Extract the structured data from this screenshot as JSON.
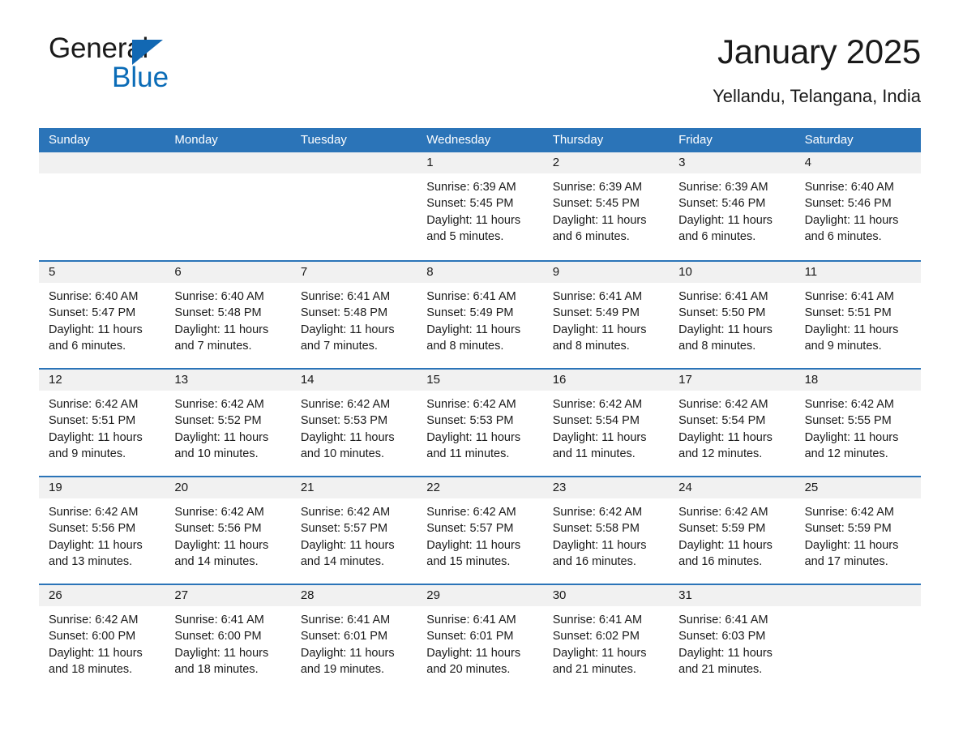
{
  "brand": {
    "name_part1": "General",
    "name_part2": "Blue",
    "triangle_color": "#1268b3"
  },
  "header": {
    "month_title": "January 2025",
    "location": "Yellandu, Telangana, India"
  },
  "theme": {
    "header_blue": "#2b74b8",
    "daynum_band": "#f1f1f1",
    "text": "#1a1a1a"
  },
  "weekdays": [
    "Sunday",
    "Monday",
    "Tuesday",
    "Wednesday",
    "Thursday",
    "Friday",
    "Saturday"
  ],
  "weeks": [
    [
      {
        "day": "",
        "sunrise": "",
        "sunset": "",
        "daylight_line1": "",
        "daylight_line2": ""
      },
      {
        "day": "",
        "sunrise": "",
        "sunset": "",
        "daylight_line1": "",
        "daylight_line2": ""
      },
      {
        "day": "",
        "sunrise": "",
        "sunset": "",
        "daylight_line1": "",
        "daylight_line2": ""
      },
      {
        "day": "1",
        "sunrise": "Sunrise: 6:39 AM",
        "sunset": "Sunset: 5:45 PM",
        "daylight_line1": "Daylight: 11 hours",
        "daylight_line2": "and 5 minutes."
      },
      {
        "day": "2",
        "sunrise": "Sunrise: 6:39 AM",
        "sunset": "Sunset: 5:45 PM",
        "daylight_line1": "Daylight: 11 hours",
        "daylight_line2": "and 6 minutes."
      },
      {
        "day": "3",
        "sunrise": "Sunrise: 6:39 AM",
        "sunset": "Sunset: 5:46 PM",
        "daylight_line1": "Daylight: 11 hours",
        "daylight_line2": "and 6 minutes."
      },
      {
        "day": "4",
        "sunrise": "Sunrise: 6:40 AM",
        "sunset": "Sunset: 5:46 PM",
        "daylight_line1": "Daylight: 11 hours",
        "daylight_line2": "and 6 minutes."
      }
    ],
    [
      {
        "day": "5",
        "sunrise": "Sunrise: 6:40 AM",
        "sunset": "Sunset: 5:47 PM",
        "daylight_line1": "Daylight: 11 hours",
        "daylight_line2": "and 6 minutes."
      },
      {
        "day": "6",
        "sunrise": "Sunrise: 6:40 AM",
        "sunset": "Sunset: 5:48 PM",
        "daylight_line1": "Daylight: 11 hours",
        "daylight_line2": "and 7 minutes."
      },
      {
        "day": "7",
        "sunrise": "Sunrise: 6:41 AM",
        "sunset": "Sunset: 5:48 PM",
        "daylight_line1": "Daylight: 11 hours",
        "daylight_line2": "and 7 minutes."
      },
      {
        "day": "8",
        "sunrise": "Sunrise: 6:41 AM",
        "sunset": "Sunset: 5:49 PM",
        "daylight_line1": "Daylight: 11 hours",
        "daylight_line2": "and 8 minutes."
      },
      {
        "day": "9",
        "sunrise": "Sunrise: 6:41 AM",
        "sunset": "Sunset: 5:49 PM",
        "daylight_line1": "Daylight: 11 hours",
        "daylight_line2": "and 8 minutes."
      },
      {
        "day": "10",
        "sunrise": "Sunrise: 6:41 AM",
        "sunset": "Sunset: 5:50 PM",
        "daylight_line1": "Daylight: 11 hours",
        "daylight_line2": "and 8 minutes."
      },
      {
        "day": "11",
        "sunrise": "Sunrise: 6:41 AM",
        "sunset": "Sunset: 5:51 PM",
        "daylight_line1": "Daylight: 11 hours",
        "daylight_line2": "and 9 minutes."
      }
    ],
    [
      {
        "day": "12",
        "sunrise": "Sunrise: 6:42 AM",
        "sunset": "Sunset: 5:51 PM",
        "daylight_line1": "Daylight: 11 hours",
        "daylight_line2": "and 9 minutes."
      },
      {
        "day": "13",
        "sunrise": "Sunrise: 6:42 AM",
        "sunset": "Sunset: 5:52 PM",
        "daylight_line1": "Daylight: 11 hours",
        "daylight_line2": "and 10 minutes."
      },
      {
        "day": "14",
        "sunrise": "Sunrise: 6:42 AM",
        "sunset": "Sunset: 5:53 PM",
        "daylight_line1": "Daylight: 11 hours",
        "daylight_line2": "and 10 minutes."
      },
      {
        "day": "15",
        "sunrise": "Sunrise: 6:42 AM",
        "sunset": "Sunset: 5:53 PM",
        "daylight_line1": "Daylight: 11 hours",
        "daylight_line2": "and 11 minutes."
      },
      {
        "day": "16",
        "sunrise": "Sunrise: 6:42 AM",
        "sunset": "Sunset: 5:54 PM",
        "daylight_line1": "Daylight: 11 hours",
        "daylight_line2": "and 11 minutes."
      },
      {
        "day": "17",
        "sunrise": "Sunrise: 6:42 AM",
        "sunset": "Sunset: 5:54 PM",
        "daylight_line1": "Daylight: 11 hours",
        "daylight_line2": "and 12 minutes."
      },
      {
        "day": "18",
        "sunrise": "Sunrise: 6:42 AM",
        "sunset": "Sunset: 5:55 PM",
        "daylight_line1": "Daylight: 11 hours",
        "daylight_line2": "and 12 minutes."
      }
    ],
    [
      {
        "day": "19",
        "sunrise": "Sunrise: 6:42 AM",
        "sunset": "Sunset: 5:56 PM",
        "daylight_line1": "Daylight: 11 hours",
        "daylight_line2": "and 13 minutes."
      },
      {
        "day": "20",
        "sunrise": "Sunrise: 6:42 AM",
        "sunset": "Sunset: 5:56 PM",
        "daylight_line1": "Daylight: 11 hours",
        "daylight_line2": "and 14 minutes."
      },
      {
        "day": "21",
        "sunrise": "Sunrise: 6:42 AM",
        "sunset": "Sunset: 5:57 PM",
        "daylight_line1": "Daylight: 11 hours",
        "daylight_line2": "and 14 minutes."
      },
      {
        "day": "22",
        "sunrise": "Sunrise: 6:42 AM",
        "sunset": "Sunset: 5:57 PM",
        "daylight_line1": "Daylight: 11 hours",
        "daylight_line2": "and 15 minutes."
      },
      {
        "day": "23",
        "sunrise": "Sunrise: 6:42 AM",
        "sunset": "Sunset: 5:58 PM",
        "daylight_line1": "Daylight: 11 hours",
        "daylight_line2": "and 16 minutes."
      },
      {
        "day": "24",
        "sunrise": "Sunrise: 6:42 AM",
        "sunset": "Sunset: 5:59 PM",
        "daylight_line1": "Daylight: 11 hours",
        "daylight_line2": "and 16 minutes."
      },
      {
        "day": "25",
        "sunrise": "Sunrise: 6:42 AM",
        "sunset": "Sunset: 5:59 PM",
        "daylight_line1": "Daylight: 11 hours",
        "daylight_line2": "and 17 minutes."
      }
    ],
    [
      {
        "day": "26",
        "sunrise": "Sunrise: 6:42 AM",
        "sunset": "Sunset: 6:00 PM",
        "daylight_line1": "Daylight: 11 hours",
        "daylight_line2": "and 18 minutes."
      },
      {
        "day": "27",
        "sunrise": "Sunrise: 6:41 AM",
        "sunset": "Sunset: 6:00 PM",
        "daylight_line1": "Daylight: 11 hours",
        "daylight_line2": "and 18 minutes."
      },
      {
        "day": "28",
        "sunrise": "Sunrise: 6:41 AM",
        "sunset": "Sunset: 6:01 PM",
        "daylight_line1": "Daylight: 11 hours",
        "daylight_line2": "and 19 minutes."
      },
      {
        "day": "29",
        "sunrise": "Sunrise: 6:41 AM",
        "sunset": "Sunset: 6:01 PM",
        "daylight_line1": "Daylight: 11 hours",
        "daylight_line2": "and 20 minutes."
      },
      {
        "day": "30",
        "sunrise": "Sunrise: 6:41 AM",
        "sunset": "Sunset: 6:02 PM",
        "daylight_line1": "Daylight: 11 hours",
        "daylight_line2": "and 21 minutes."
      },
      {
        "day": "31",
        "sunrise": "Sunrise: 6:41 AM",
        "sunset": "Sunset: 6:03 PM",
        "daylight_line1": "Daylight: 11 hours",
        "daylight_line2": "and 21 minutes."
      },
      {
        "day": "",
        "sunrise": "",
        "sunset": "",
        "daylight_line1": "",
        "daylight_line2": ""
      }
    ]
  ]
}
